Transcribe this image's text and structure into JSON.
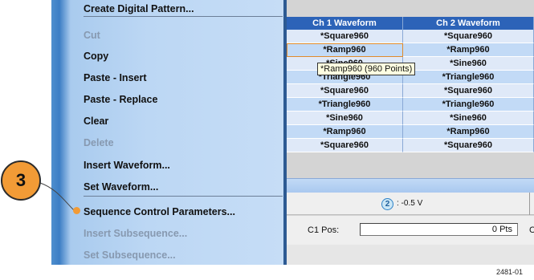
{
  "menu": {
    "items": [
      {
        "label": "Create Digital Pattern...",
        "enabled": true
      },
      {
        "label": "Cut",
        "enabled": false
      },
      {
        "label": "Copy",
        "enabled": true
      },
      {
        "label": "Paste - Insert",
        "enabled": true
      },
      {
        "label": "Paste - Replace",
        "enabled": true
      },
      {
        "label": "Clear",
        "enabled": true
      },
      {
        "label": "Delete",
        "enabled": false
      },
      {
        "label": "Insert Waveform...",
        "enabled": true
      },
      {
        "label": "Set Waveform...",
        "enabled": true
      },
      {
        "label": "Sequence Control Parameters...",
        "enabled": true
      },
      {
        "label": "Insert Subsequence...",
        "enabled": false
      },
      {
        "label": "Set Subsequence...",
        "enabled": false
      }
    ]
  },
  "table": {
    "columns": [
      "Ch 1 Waveform",
      "Ch 2 Waveform"
    ],
    "rows": [
      [
        "*Square960",
        "*Square960"
      ],
      [
        "*Ramp960",
        "*Ramp960"
      ],
      [
        "*Sine960",
        "*Sine960"
      ],
      [
        "*Triangle960",
        "*Triangle960"
      ],
      [
        "*Square960",
        "*Square960"
      ],
      [
        "*Triangle960",
        "*Triangle960"
      ],
      [
        "*Sine960",
        "*Sine960"
      ],
      [
        "*Ramp960",
        "*Ramp960"
      ],
      [
        "*Square960",
        "*Square960"
      ]
    ]
  },
  "tooltip": {
    "text": "*Ramp960 (960 Points)"
  },
  "status": {
    "badge": "2",
    "text": ": -0.5 V"
  },
  "position": {
    "label": "C1 Pos:",
    "value": "0 Pts",
    "extra": "C"
  },
  "callout": {
    "number": "3"
  },
  "figure_id": "2481-01",
  "colors": {
    "accent": "#f29b36",
    "header": "#2c63b8",
    "menu_edge": "#2d5a93"
  }
}
